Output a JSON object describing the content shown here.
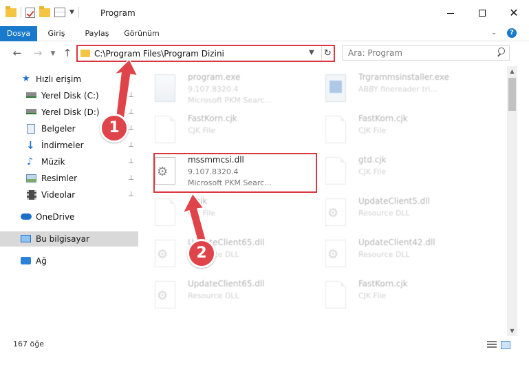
{
  "window": {
    "title": "Program",
    "minimize_icon": "minimize-icon",
    "maximize_icon": "maximize-icon",
    "close_icon": "close-icon"
  },
  "ribbon": {
    "tabs": [
      {
        "label": "Dosya",
        "active": true
      },
      {
        "label": "Giriş"
      },
      {
        "label": "Paylaş"
      },
      {
        "label": "Görünüm"
      }
    ],
    "help": "?"
  },
  "nav": {
    "back": "←",
    "forward": "→",
    "recent": "⌄",
    "up": "↑",
    "address": "C:\\Program Files\\Program Dizini",
    "dropdown": "⌄",
    "refresh": "↻",
    "search_placeholder": "Ara: Program"
  },
  "sidebar": {
    "items": [
      {
        "label": "Hızlı erişim",
        "icon": "star-icon"
      },
      {
        "label": "Yerel Disk (C:)",
        "icon": "disk-icon",
        "pinned": true
      },
      {
        "label": "Yerel Disk (D:)",
        "icon": "disk-icon",
        "pinned": true
      },
      {
        "label": "Belgeler",
        "icon": "documents-icon",
        "pinned": true
      },
      {
        "label": "İndirmeler",
        "icon": "downloads-icon",
        "pinned": true
      },
      {
        "label": "Müzik",
        "icon": "music-icon",
        "pinned": true
      },
      {
        "label": "Resimler",
        "icon": "pictures-icon",
        "pinned": true
      },
      {
        "label": "Videolar",
        "icon": "videos-icon",
        "pinned": true
      },
      {
        "label": "OneDrive",
        "icon": "onedrive-icon"
      },
      {
        "label": "Bu bilgisayar",
        "icon": "computer-icon",
        "selected": true
      },
      {
        "label": "Ağ",
        "icon": "network-icon"
      }
    ],
    "pin_glyph": "📌"
  },
  "files": [
    {
      "name": "program.exe",
      "meta1": "9.107.8320.4",
      "meta2": "Microsoft PKM Searc...",
      "icon": "exe-icon"
    },
    {
      "name": "Trgrammsinstaller.exe",
      "meta1": "ABBY finereader tri...",
      "meta2": "",
      "icon": "installer-icon"
    },
    {
      "name": "FastKorn.cjk",
      "meta1": "CJK File",
      "meta2": "",
      "icon": "file-icon"
    },
    {
      "name": "FastKorn.cjk",
      "meta1": "CJK File",
      "meta2": "",
      "icon": "file-icon"
    },
    {
      "name": "mssmmcsi.dll",
      "meta1": "9.107.8320.4",
      "meta2": "Microsoft PKM Searc...",
      "icon": "dll-gear-icon"
    },
    {
      "name": "gtd.cjk",
      "meta1": "CJK File",
      "meta2": "",
      "icon": "file-icon"
    },
    {
      "name": "...cjk",
      "meta1": "CJK File",
      "meta2": "",
      "icon": "file-icon"
    },
    {
      "name": "UpdateClient5.dll",
      "meta1": "Resource DLL",
      "meta2": "",
      "icon": "dll-gear-icon"
    },
    {
      "name": "UpdateClient65.dll",
      "meta1": "Resource DLL",
      "meta2": "",
      "icon": "dll-gear-icon"
    },
    {
      "name": "UpdateClient42.dll",
      "meta1": "Resource DLL",
      "meta2": "",
      "icon": "dll-gear-icon"
    },
    {
      "name": "UpdateClient65.dll",
      "meta1": "Resource DLL",
      "meta2": "",
      "icon": "dll-gear-icon"
    },
    {
      "name": "FastKorn.cjk",
      "meta1": "CJK File",
      "meta2": "",
      "icon": "file-icon"
    }
  ],
  "annotations": {
    "badge1": "1",
    "badge2": "2",
    "highlight_color": "#d9363e",
    "badge_color": "#e0444b"
  },
  "status": {
    "item_count": "167 öğe"
  },
  "colors": {
    "accent": "#1979ca",
    "selection": "#d9d9d9"
  }
}
